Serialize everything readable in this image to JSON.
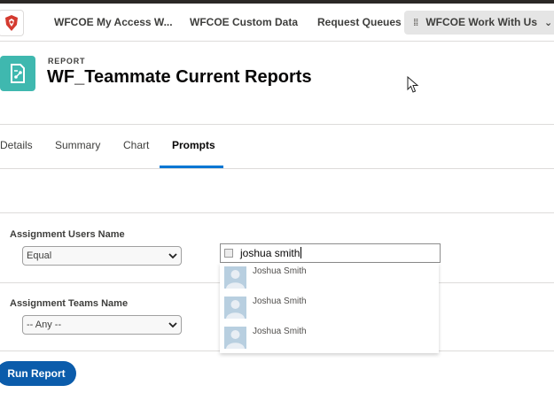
{
  "nav": {
    "items": [
      {
        "label": "WFCOE My Access W..."
      },
      {
        "label": "WFCOE Custom Data"
      },
      {
        "label": "Request Queues"
      },
      {
        "label": "WFCOE Work With Us",
        "active": true
      }
    ]
  },
  "header": {
    "eyebrow": "REPORT",
    "title": "WF_Teammate Current Reports",
    "icon": "report-icon",
    "icon_color": "#3fb8af"
  },
  "tabs": [
    {
      "label": "Details"
    },
    {
      "label": "Summary"
    },
    {
      "label": "Chart"
    },
    {
      "label": "Prompts",
      "active": true
    }
  ],
  "filters": {
    "users": {
      "label": "Assignment Users Name",
      "operator": "Equal",
      "lookup_value": "joshua smith"
    },
    "teams": {
      "label": "Assignment Teams Name",
      "operator": "-- Any --"
    }
  },
  "suggestions": [
    {
      "name": "Joshua Smith"
    },
    {
      "name": "Joshua Smith"
    },
    {
      "name": "Joshua Smith"
    }
  ],
  "run_button": {
    "label": "Run Report",
    "color": "#0b5cab"
  },
  "colors": {
    "accent": "#0176d3",
    "tab_underline": "#0176d3"
  }
}
